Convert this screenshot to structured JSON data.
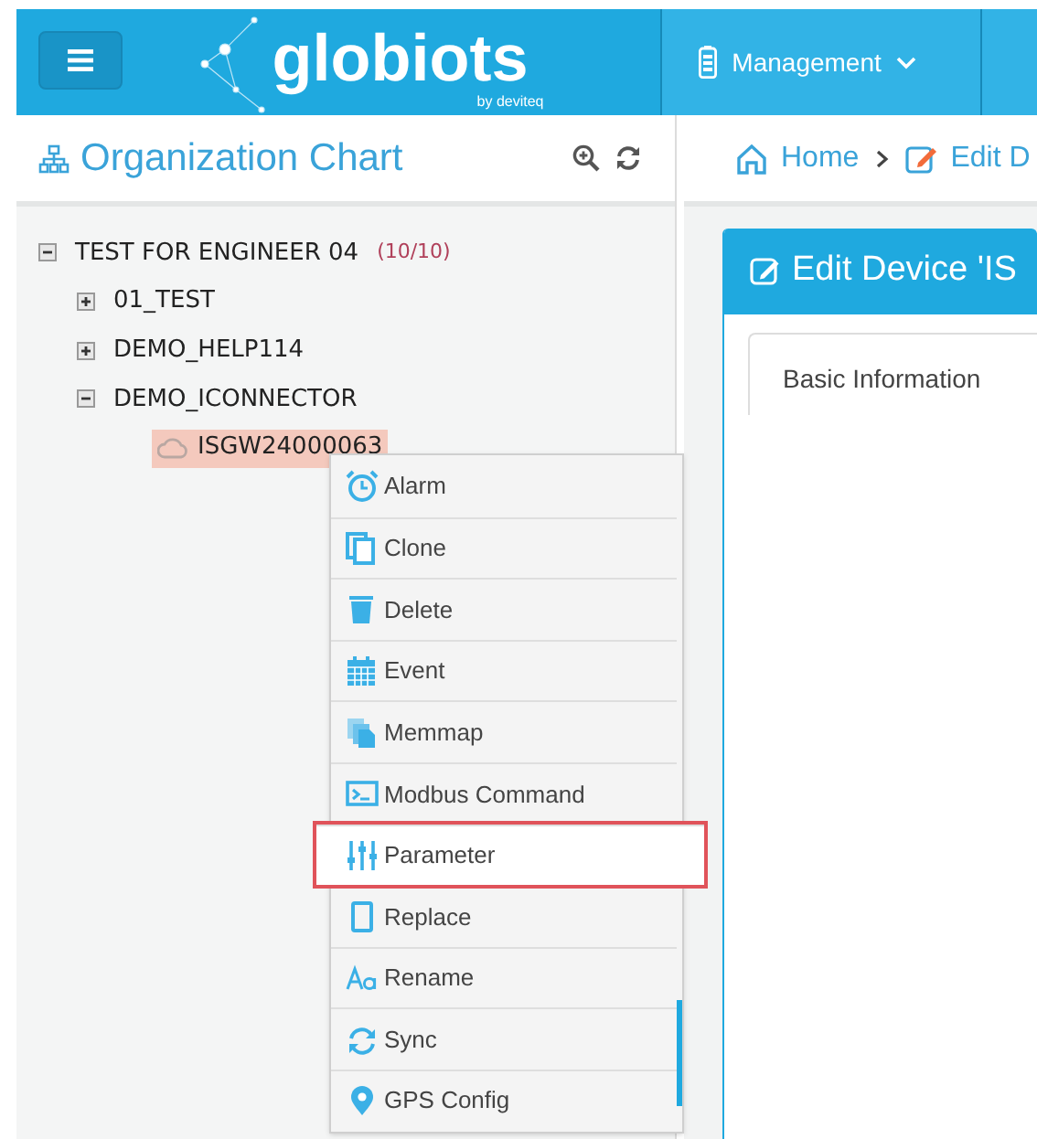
{
  "header": {
    "logo": "globiots",
    "logo_byline": "by deviteq",
    "nav": [
      {
        "label": "Management"
      }
    ]
  },
  "org_panel": {
    "title": "Organization Chart",
    "tree": [
      {
        "label": "TEST FOR ENGINEER 04",
        "count": "(10/10)",
        "expanded": true,
        "selected": false,
        "children": [
          {
            "label": "01_TEST",
            "expanded": false,
            "selected": false
          },
          {
            "label": "DEMO_HELP114",
            "expanded": false,
            "selected": false
          },
          {
            "label": "DEMO_ICONNECTOR",
            "expanded": true,
            "selected": false,
            "children": [
              {
                "label": "ISGW24000063",
                "kind": "device",
                "selected": true
              }
            ]
          }
        ]
      }
    ]
  },
  "context_menu": [
    {
      "label": "Alarm",
      "selected": false
    },
    {
      "label": "Clone",
      "selected": false
    },
    {
      "label": "Delete",
      "selected": false
    },
    {
      "label": "Event",
      "selected": false
    },
    {
      "label": "Memmap",
      "selected": false
    },
    {
      "label": "Modbus Command",
      "selected": false
    },
    {
      "label": "Parameter",
      "selected": true
    },
    {
      "label": "Replace",
      "selected": false
    },
    {
      "label": "Rename",
      "selected": false
    },
    {
      "label": "Sync",
      "selected": false
    },
    {
      "label": "GPS Config",
      "selected": false
    }
  ],
  "breadcrumb": [
    "Home",
    "Edit D"
  ],
  "card": {
    "title": "Edit Device 'IS",
    "tabs": [
      {
        "label": "Basic Information"
      }
    ]
  }
}
